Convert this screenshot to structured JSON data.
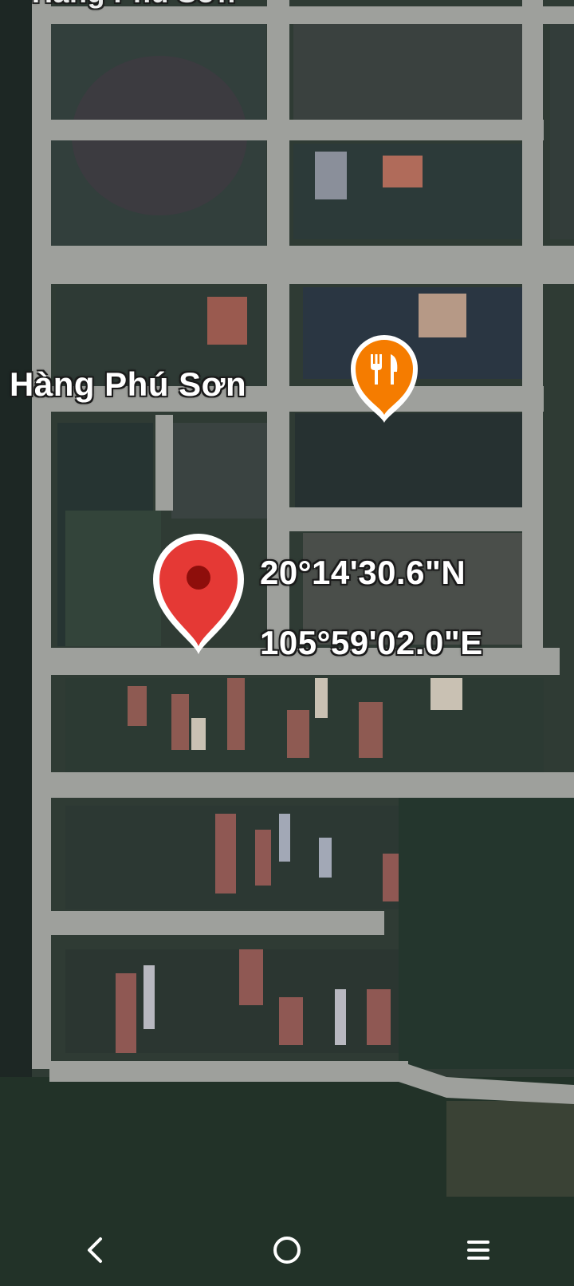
{
  "map": {
    "top_label": "Hàng Phú Sơn",
    "poi": {
      "name": "Hàng Phú Sơn",
      "category_icon": "restaurant-fork-knife-icon",
      "color": "#F57C00"
    },
    "dropped_pin": {
      "latitude": "20°14'30.6\"N",
      "longitude": "105°59'02.0\"E",
      "color": "#E53935"
    }
  },
  "nav_bar": {
    "buttons": [
      {
        "icon": "back-chevron-icon"
      },
      {
        "icon": "home-circle-icon"
      },
      {
        "icon": "recents-menu-icon"
      }
    ]
  }
}
